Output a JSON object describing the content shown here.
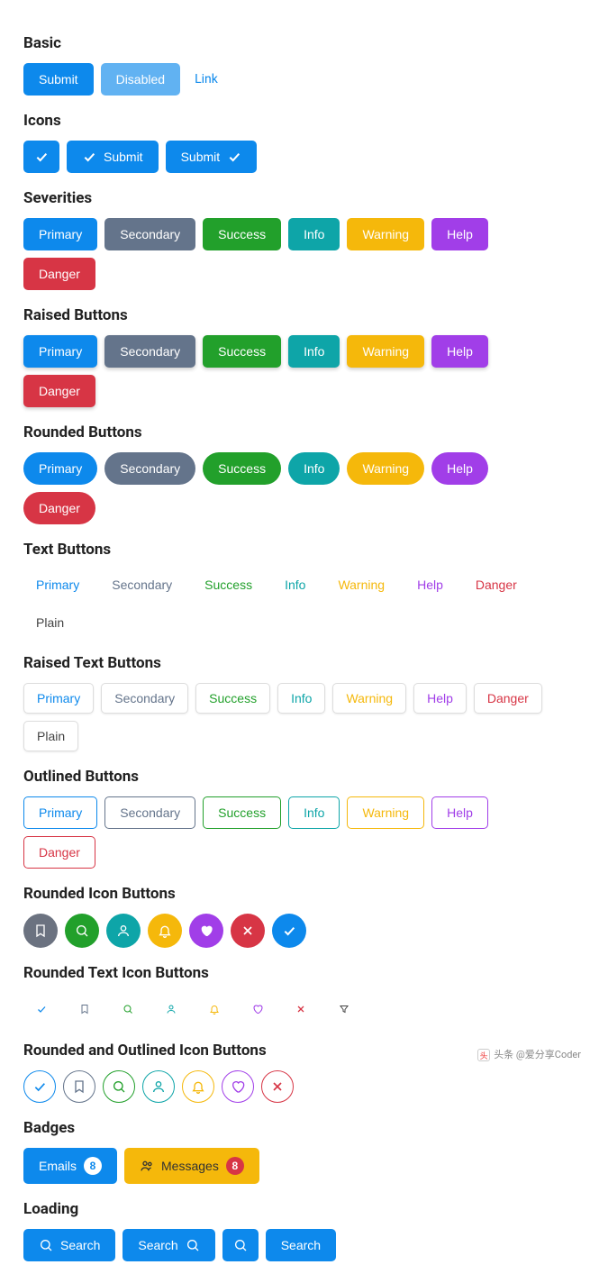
{
  "sections": {
    "basic": "Basic",
    "icons": "Icons",
    "severities": "Severities",
    "raised": "Raised Buttons",
    "rounded": "Rounded Buttons",
    "text": "Text Buttons",
    "raised_text": "Raised Text Buttons",
    "outlined": "Outlined Buttons",
    "rounded_icon": "Rounded Icon Buttons",
    "rounded_text_icon": "Rounded Text Icon Buttons",
    "rounded_outlined_icon": "Rounded and Outlined Icon Buttons",
    "badges": "Badges",
    "loading": "Loading"
  },
  "basic": {
    "submit": "Submit",
    "disabled": "Disabled",
    "link": "Link"
  },
  "icons": {
    "submit": "Submit"
  },
  "sev": {
    "primary": "Primary",
    "secondary": "Secondary",
    "success": "Success",
    "info": "Info",
    "warning": "Warning",
    "help": "Help",
    "danger": "Danger",
    "plain": "Plain"
  },
  "badges_row": {
    "emails": "Emails",
    "emails_count": "8",
    "messages": "Messages",
    "messages_count": "8"
  },
  "loading": {
    "search": "Search"
  },
  "watermark": "头条 @爱分享Coder"
}
